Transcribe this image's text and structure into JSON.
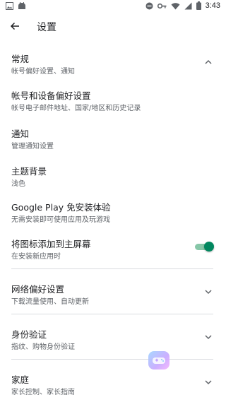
{
  "status_bar": {
    "time": "3:43",
    "left_icons": [
      "image-icon",
      "android-icon"
    ],
    "right_icons": [
      "dnd-icon",
      "key-icon",
      "wifi-icon",
      "cell-icon",
      "battery-icon"
    ]
  },
  "toolbar": {
    "title": "设置"
  },
  "sections": [
    {
      "id": "general",
      "title": "常规",
      "subtitle": "帐号偏好设置、通知",
      "expanded": true,
      "items": [
        {
          "title": "帐号和设备偏好设置",
          "subtitle": "帐号电子邮件地址、国家/地区和历史记录"
        },
        {
          "title": "通知",
          "subtitle": "管理通知设置"
        },
        {
          "title": "主题背景",
          "subtitle": "浅色"
        },
        {
          "title": "Google Play 免安装体验",
          "subtitle": "无需安装即可使用应用及玩游戏"
        },
        {
          "title": "将图标添加到主屏幕",
          "subtitle": "在安装新应用时",
          "toggle": true
        }
      ]
    },
    {
      "id": "network",
      "title": "网络偏好设置",
      "subtitle": "下载流量使用、自动更新",
      "expanded": false
    },
    {
      "id": "auth",
      "title": "身份验证",
      "subtitle": "指纹、购物身份验证",
      "expanded": false
    },
    {
      "id": "family",
      "title": "家庭",
      "subtitle": "家长控制、家长指南",
      "expanded": false
    }
  ],
  "colors": {
    "accent": "#01875f",
    "divider": "#dadce0",
    "secondary_text": "#5f6368"
  }
}
